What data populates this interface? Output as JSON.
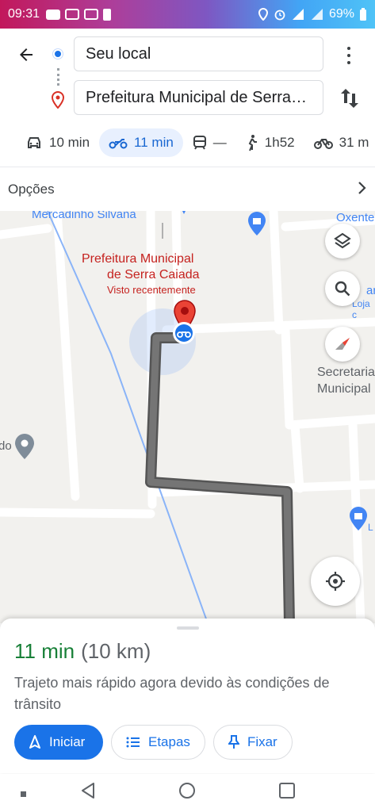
{
  "status_bar": {
    "time": "09:31",
    "battery": "69%"
  },
  "header": {
    "origin_value": "Seu local",
    "destination_value": "Prefeitura Municipal de Serra…"
  },
  "modes": [
    {
      "icon": "car-icon",
      "label": "10 min"
    },
    {
      "icon": "motorcycle-icon",
      "label": "11 min"
    },
    {
      "icon": "transit-icon",
      "label": "—"
    },
    {
      "icon": "walk-icon",
      "label": "1h52"
    },
    {
      "icon": "bike-icon",
      "label": "31 m"
    }
  ],
  "options": {
    "label": "Opções"
  },
  "map": {
    "poi_mercadinho": "Mercadinho Silvana",
    "poi_oxente": "Oxente",
    "dest_title_line1": "Prefeitura Municipal",
    "dest_title_line2": "de Serra Caiada",
    "dest_subtitle": "Visto recentemente",
    "poi_secretaria_1": "Secretaria",
    "poi_secretaria_2": "Municipal",
    "poi_right_1": "ar",
    "poi_right_2": "Loja c",
    "poi_left": "do",
    "poi_right_3": "L"
  },
  "sheet": {
    "eta_time": "11 min",
    "eta_distance": "(10 km)",
    "description": "Trajeto mais rápido agora devido às condições de trânsito",
    "start_label": "Iniciar",
    "steps_label": "Etapas",
    "pin_label": "Fixar"
  },
  "colors": {
    "accent": "#1a73e8",
    "eta_green": "#188038",
    "route": "#6b6b6b",
    "dest_red": "#d93025"
  }
}
